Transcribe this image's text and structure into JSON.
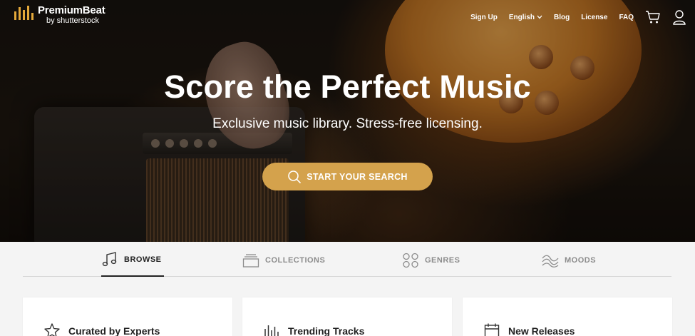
{
  "brand": {
    "name": "PremiumBeat",
    "sub": "by shutterstock",
    "bar_color": "#e3a83a"
  },
  "nav": {
    "sign_up": "Sign Up",
    "language": "English",
    "blog": "Blog",
    "license": "License",
    "faq": "FAQ",
    "cart_icon": "cart-icon",
    "account_icon": "user-icon"
  },
  "hero": {
    "title": "Score the Perfect Music",
    "subtitle": "Exclusive music library. Stress-free licensing.",
    "cta_label": "START YOUR SEARCH",
    "cta_color": "#d4a24c",
    "cta_icon": "search-icon"
  },
  "tabs": [
    {
      "label": "BROWSE",
      "icon": "music-note-icon",
      "active": true
    },
    {
      "label": "COLLECTIONS",
      "icon": "collections-icon",
      "active": false
    },
    {
      "label": "GENRES",
      "icon": "genres-icon",
      "active": false
    },
    {
      "label": "MOODS",
      "icon": "moods-icon",
      "active": false
    }
  ],
  "cards": [
    {
      "title": "Curated by Experts",
      "icon": "star-icon"
    },
    {
      "title": "Trending Tracks",
      "icon": "equalizer-icon"
    },
    {
      "title": "New Releases",
      "icon": "calendar-icon"
    }
  ]
}
